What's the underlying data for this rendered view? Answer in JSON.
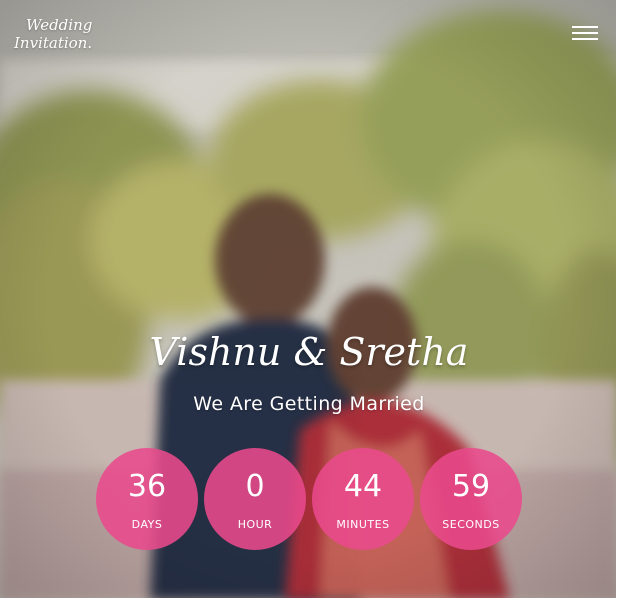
{
  "header": {
    "logo_line1": "Wedding",
    "logo_line2": "Invitation.",
    "menu_icon": "hamburger-menu-icon"
  },
  "hero": {
    "couple_names": "Vishnu & Sretha",
    "tagline": "We Are Getting Married",
    "photo_alt": "couple photo"
  },
  "countdown": {
    "accent_color": "#e94a8c",
    "items": [
      {
        "value": "36",
        "label": "DAYS"
      },
      {
        "value": "0",
        "label": "HOUR"
      },
      {
        "value": "44",
        "label": "MINUTES"
      },
      {
        "value": "59",
        "label": "SECONDS"
      }
    ]
  }
}
